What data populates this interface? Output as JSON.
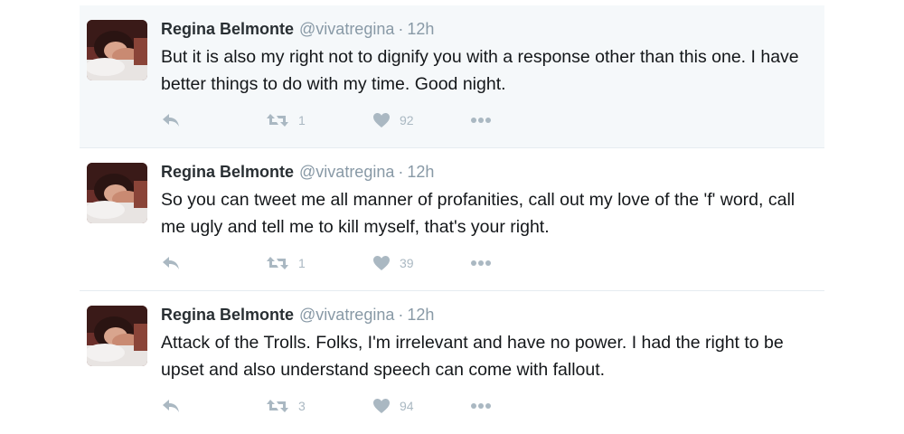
{
  "tweets": [
    {
      "name": "Regina Belmonte",
      "handle": "@vivatregina",
      "dot": "·",
      "time": "12h",
      "text": "But it is also my right not to dignify you with a response other than this one. I have better things to do with my time. Good night.",
      "retweets": "1",
      "likes": "92",
      "highlighted": true
    },
    {
      "name": "Regina Belmonte",
      "handle": "@vivatregina",
      "dot": "·",
      "time": "12h",
      "text": "So you can tweet me all manner of profanities, call out my love of the 'f' word, call me ugly and tell me to kill myself, that's your right.",
      "retweets": "1",
      "likes": "39",
      "highlighted": false
    },
    {
      "name": "Regina Belmonte",
      "handle": "@vivatregina",
      "dot": "·",
      "time": "12h",
      "text": "Attack of the Trolls. Folks, I'm irrelevant and have no power. I had the right to be upset and also understand speech can come with fallout.",
      "retweets": "3",
      "likes": "94",
      "highlighted": false
    }
  ],
  "icons": {
    "reply": "reply-icon",
    "retweet": "retweet-icon",
    "like": "heart-icon",
    "more": "more-icon"
  },
  "colors": {
    "action_gray": "#aab8c2",
    "secondary_text": "#8899a6",
    "highlight_bg": "#f5f8fa"
  }
}
